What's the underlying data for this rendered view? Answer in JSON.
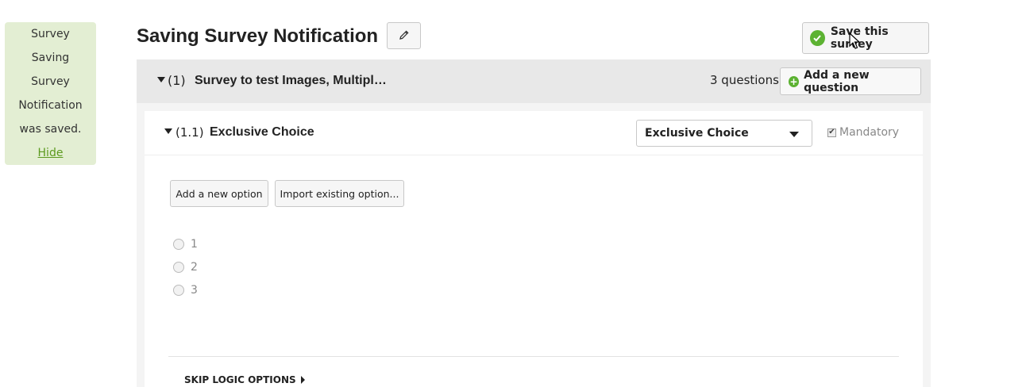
{
  "notification": {
    "lines": [
      "Survey",
      "Saving",
      "Survey",
      "Notification",
      "was saved."
    ],
    "hide_label": "Hide"
  },
  "header": {
    "title": "Saving Survey Notification",
    "save_label": "Save this survey"
  },
  "section": {
    "number": "(1)",
    "name": "Survey to test Images, Multipl…",
    "question_count": "3 questions",
    "add_question_label": "Add a new question"
  },
  "question": {
    "number": "(1.1)",
    "name": "Exclusive Choice",
    "type_selected": "Exclusive Choice",
    "mandatory_label": "Mandatory",
    "add_option_label": "Add a new option",
    "import_option_label": "Import existing option...",
    "options": [
      "1",
      "2",
      "3"
    ],
    "skip_logic_label": "SKIP LOGIC OPTIONS"
  },
  "colors": {
    "notification_bg": "#e3eed3",
    "link_green": "#5c9a1f",
    "accent_green": "#5cb232",
    "section_bar": "#e8e8e8"
  }
}
